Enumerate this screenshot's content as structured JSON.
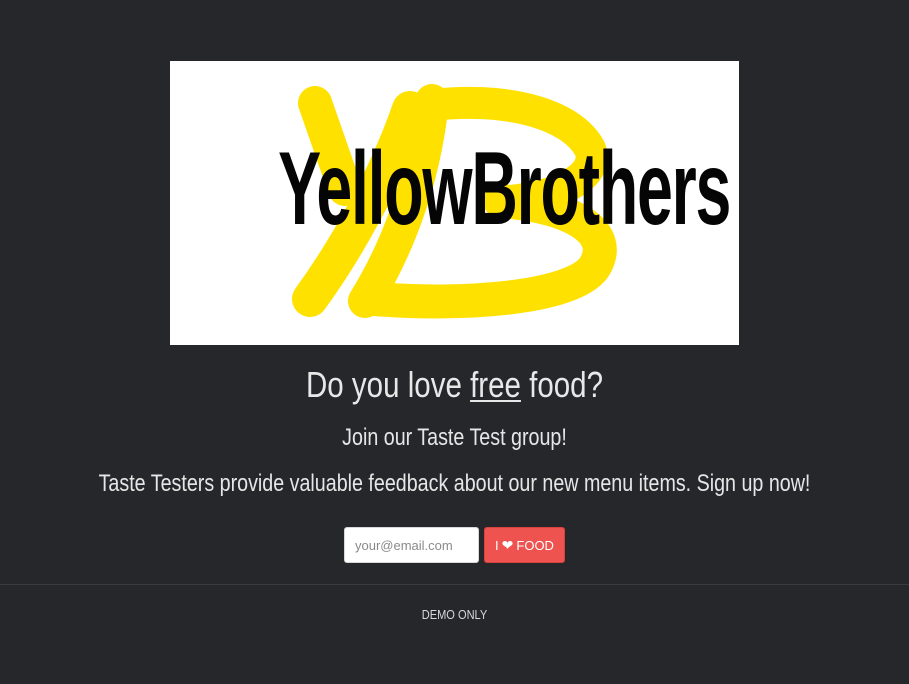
{
  "logo": {
    "wordmark": "YellowBrothers",
    "monogram": "YB",
    "brand_color": "#FFE100",
    "text_color": "#050505"
  },
  "hero": {
    "headline_before": "Do you love ",
    "headline_emphasis": "free",
    "headline_after": " food?",
    "subheading": "Join our Taste Test group!",
    "description": "Taste Testers provide valuable feedback about our new menu items. Sign up now!"
  },
  "signup": {
    "email_placeholder": "your@email.com",
    "email_value": "",
    "button_prefix": "I",
    "button_icon": "heart-icon",
    "button_suffix": "FOOD",
    "button_color": "#EF5350"
  },
  "footer": {
    "label": "DEMO ONLY"
  },
  "theme": {
    "background": "#26272B"
  }
}
